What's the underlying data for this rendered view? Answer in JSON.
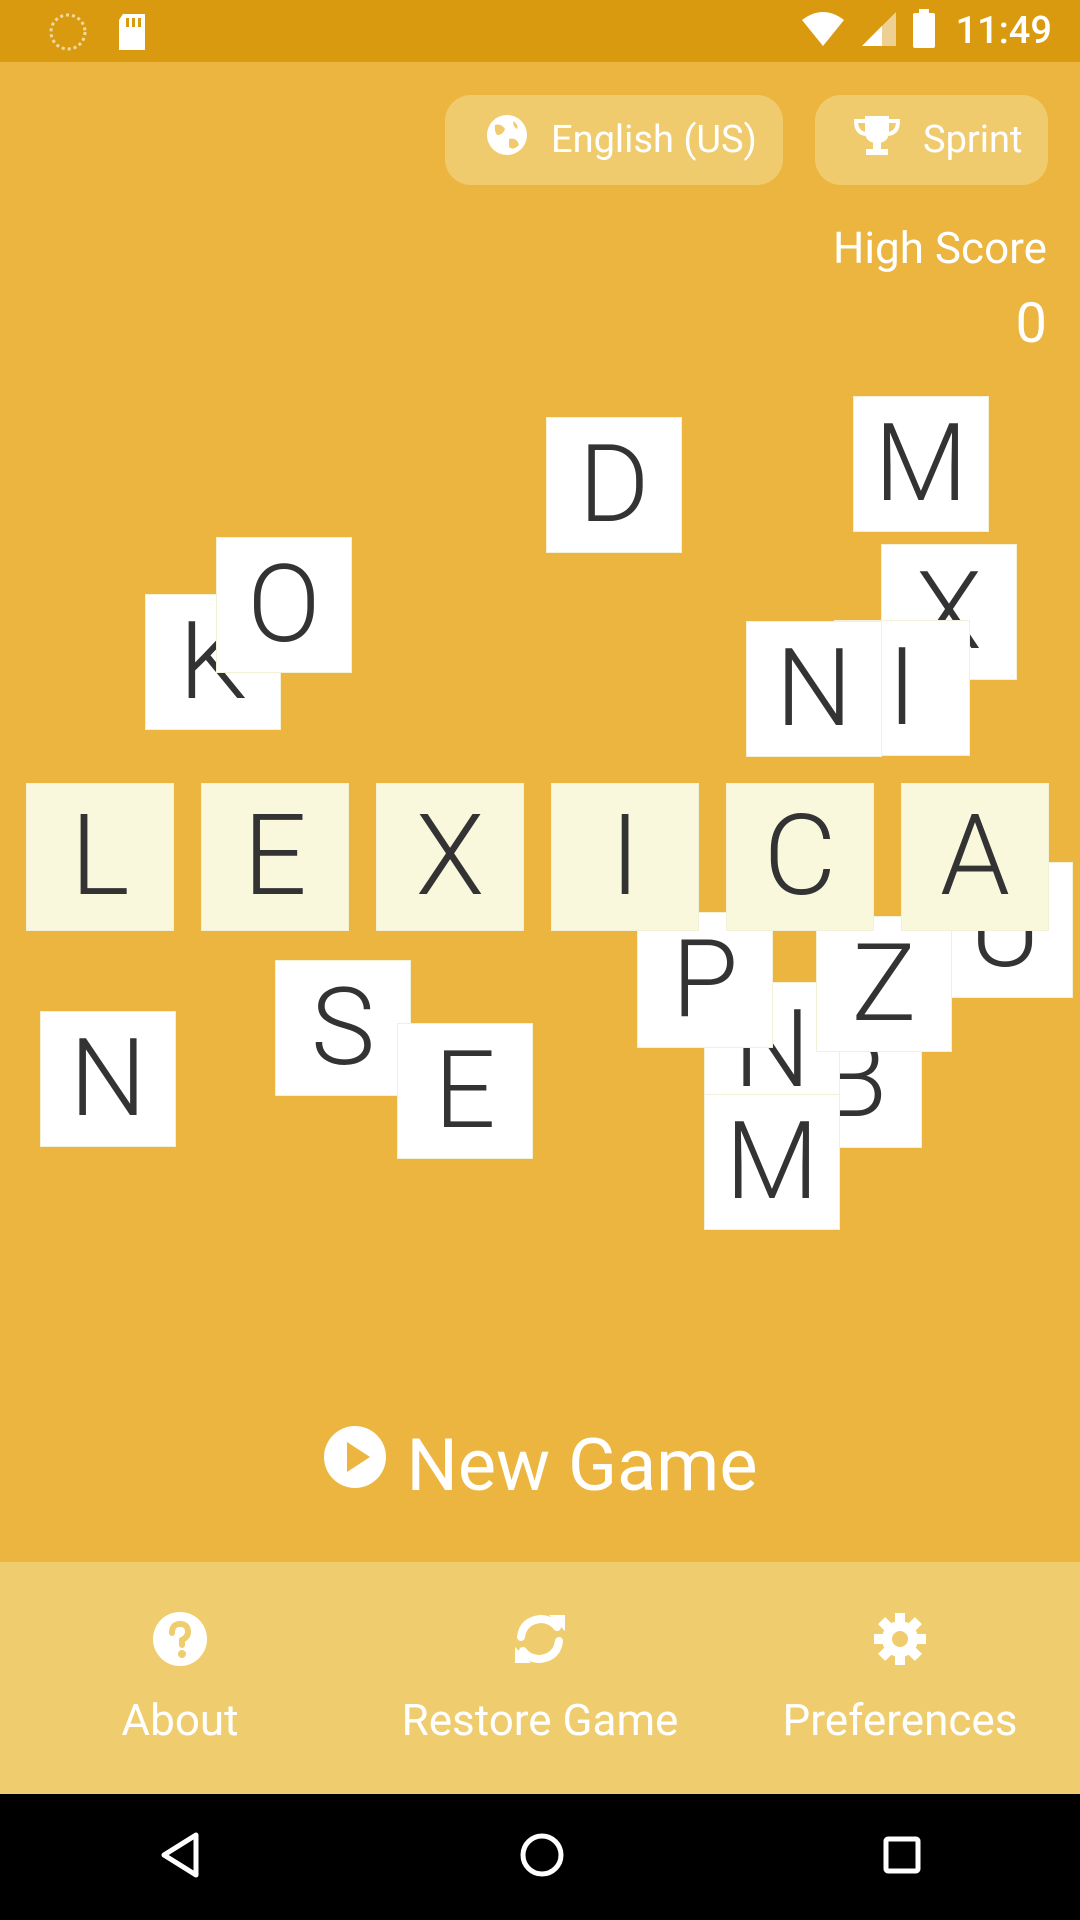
{
  "status_bar": {
    "time": "11:49",
    "icons": [
      "loading-indicator-icon",
      "sd-card-icon",
      "wifi-icon",
      "signal-icon",
      "battery-icon"
    ]
  },
  "top": {
    "language_label": "English (US)",
    "language_icon": "globe-icon",
    "mode_label": "Sprint",
    "mode_icon": "trophy-icon"
  },
  "high_score": {
    "label": "High Score",
    "value": "0"
  },
  "tiles": {
    "title_letters": [
      "L",
      "E",
      "X",
      "I",
      "C",
      "A"
    ],
    "scattered_letters": [
      "M",
      "D",
      "O",
      "K",
      "X",
      "N",
      "I",
      "P",
      "Z",
      "N",
      "B",
      "M",
      "U",
      "N",
      "S",
      "E"
    ]
  },
  "actions": {
    "new_game": "New Game",
    "new_game_icon": "play-circle-icon"
  },
  "bottom_bar": {
    "items": [
      {
        "label": "About",
        "icon": "help-icon"
      },
      {
        "label": "Restore Game",
        "icon": "refresh-icon"
      },
      {
        "label": "Preferences",
        "icon": "gear-icon"
      }
    ]
  },
  "navigation": {
    "icons": [
      "back-icon",
      "home-icon",
      "recents-icon"
    ]
  },
  "colors": {
    "background": "#EBB540",
    "status_bar": "#D99A0F",
    "bottom_bar": "#EFCD6E",
    "title_tile": "#FAF8DC",
    "tile": "#FFFFFF",
    "text": "#FFFFFF"
  }
}
